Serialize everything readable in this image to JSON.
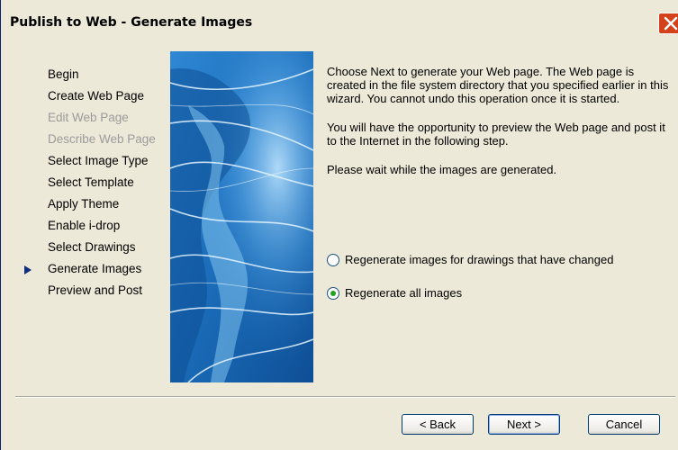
{
  "window": {
    "title": "Publish to Web - Generate Images"
  },
  "steps": [
    {
      "label": "Begin",
      "state": "normal"
    },
    {
      "label": "Create Web Page",
      "state": "normal"
    },
    {
      "label": "Edit Web Page",
      "state": "disabled"
    },
    {
      "label": "Describe Web Page",
      "state": "disabled"
    },
    {
      "label": "Select Image Type",
      "state": "normal"
    },
    {
      "label": "Select Template",
      "state": "normal"
    },
    {
      "label": "Apply Theme",
      "state": "normal"
    },
    {
      "label": "Enable i-drop",
      "state": "normal"
    },
    {
      "label": "Select Drawings",
      "state": "normal"
    },
    {
      "label": "Generate Images",
      "state": "current"
    },
    {
      "label": "Preview and Post",
      "state": "normal"
    }
  ],
  "content": {
    "para1": "Choose Next to generate your Web page.  The Web page is created in the file system directory that you specified earlier in this wizard.  You cannot undo this operation once it is started.",
    "para2": "You will have the opportunity to preview the Web page and post it to the Internet in the following step.",
    "para3": "Please wait while the images are generated."
  },
  "options": {
    "changed_label": "Regenerate images for drawings that have changed",
    "all_label": "Regenerate all images",
    "selected": "all"
  },
  "buttons": {
    "back": "< Back",
    "next": "Next >",
    "cancel": "Cancel"
  },
  "colors": {
    "dialog_bg": "#ece9d8",
    "disabled_text": "#9b9b9b",
    "close_button": "#d4421b",
    "radio_dot": "#21a121"
  }
}
